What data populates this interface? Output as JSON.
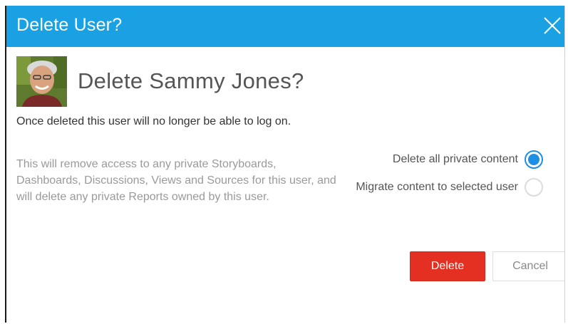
{
  "dialog": {
    "title": "Delete User?",
    "close_icon": "close-icon",
    "title_bar_color": "#1aa1e3"
  },
  "user": {
    "avatar_icon": "user-avatar-photo",
    "headline": "Delete Sammy Jones?"
  },
  "messages": {
    "warning": "Once deleted this user will no longer be able to log on.",
    "description": "This will remove access to any private Storyboards, Dashboards, Discussions, Views and Sources for this user, and will delete any private Reports owned by this user."
  },
  "options": [
    {
      "label": "Delete all private content",
      "selected": true
    },
    {
      "label": "Migrate content to selected user",
      "selected": false
    }
  ],
  "buttons": {
    "delete_label": "Delete",
    "cancel_label": "Cancel",
    "delete_color": "#e33022"
  },
  "colors": {
    "accent": "#1f8fe6"
  }
}
